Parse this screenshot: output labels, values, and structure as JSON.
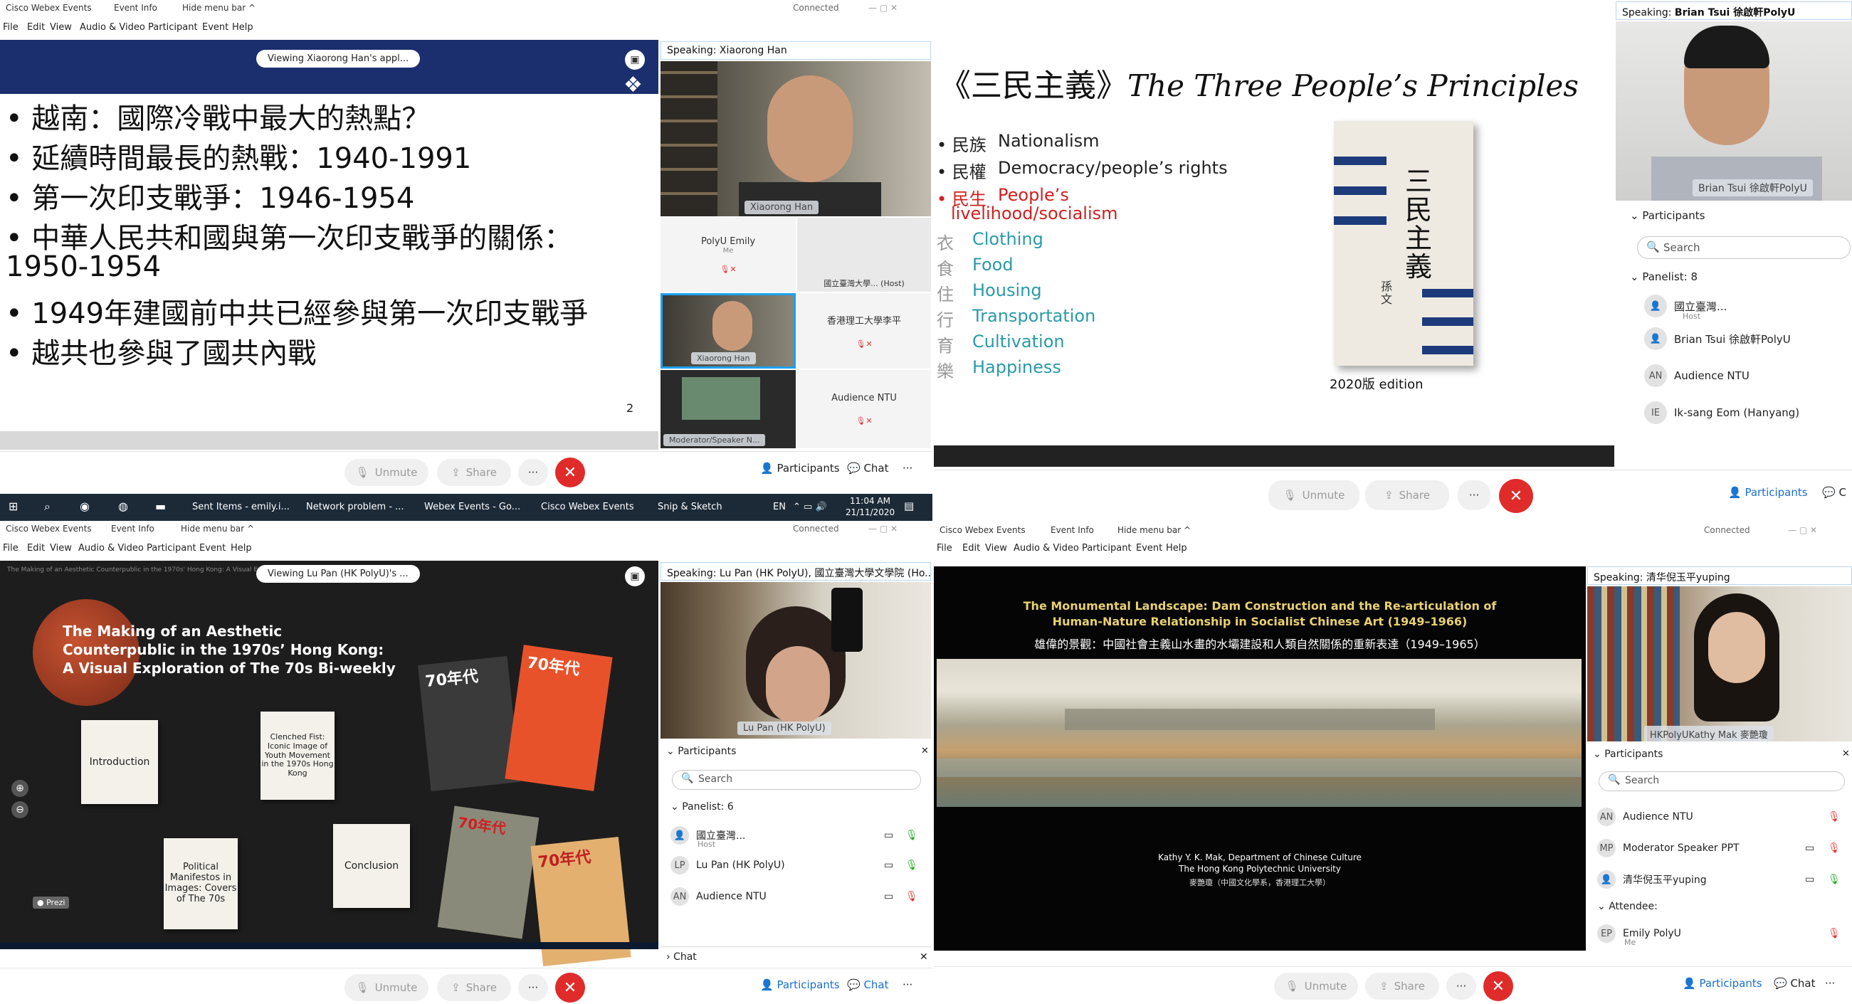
{
  "q1": {
    "menubar": {
      "app": "Cisco Webex Events",
      "event_info": "Event Info",
      "hide_menu": "Hide menu bar ^",
      "connected": "Connected"
    },
    "menu": [
      "File",
      "Edit",
      "View",
      "Audio & Video",
      "Participant",
      "Event",
      "Help"
    ],
    "viewing_pill": "Viewing Xiaorong Han's appl...",
    "slide_bullets": [
      "• 越南：國際冷戰中最大的熱點？",
      "• 延續時間最長的熱戰：1940-1991",
      "• 第一次印支戰爭：1946-1954",
      "• 中華人民共和國與第一次印支戰爭的關係：",
      "  1950-1954",
      "• 1949年建國前中共已經參與第一次印支戰爭",
      "• 越共也參與了國共內戰"
    ],
    "slide_page": "2",
    "speaking_label": "Speaking:",
    "speaking_name": "Xiaorong Han",
    "main_nameplate": "Xiaorong Han",
    "tiles": {
      "polyu_emily": "PolyU Emily",
      "me": "Me",
      "ntu_tile_name": "國立臺灣大學... (Host)",
      "xiaorong": "Xiaorong Han",
      "hk_polyu": "香港理工大學李平",
      "audience_ntu": "Audience NTU",
      "moderator": "Moderator/Speaker N..."
    },
    "controls": {
      "unmute": "Unmute",
      "share": "Share",
      "more": "···",
      "participants": "Participants",
      "chat": "Chat"
    }
  },
  "q2": {
    "title_cn": "《三民主義》",
    "title_en": "The Three People’s Principles",
    "items": [
      {
        "cn": "• 民族",
        "en": "Nationalism",
        "color": "#222"
      },
      {
        "cn": "• 民權",
        "en": "Democracy/people’s rights",
        "color": "#222"
      },
      {
        "cn": "• 民生",
        "en": "People’s",
        "color": "#d02020"
      }
    ],
    "livelihood": "livelihood/socialism",
    "sub": [
      {
        "cn": "衣",
        "en": "Clothing"
      },
      {
        "cn": "食",
        "en": "Food"
      },
      {
        "cn": "住",
        "en": "Housing"
      },
      {
        "cn": "行",
        "en": "Transportation"
      },
      {
        "cn": "育",
        "en": "Cultivation"
      },
      {
        "cn": "樂",
        "en": "Happiness"
      }
    ],
    "book_title": "三民主義",
    "book_author": "孫文",
    "edition": "2020版 edition",
    "speaking_label": "Speaking:",
    "speaking_name": "Brian Tsui 徐啟軒PolyU",
    "video_nameplate": "Brian Tsui 徐啟軒PolyU",
    "participants_title": "Participants",
    "search": "Search",
    "panelist": "Panelist: 8",
    "people": [
      {
        "av": "👤",
        "name": "國立臺灣...",
        "sub": "Host"
      },
      {
        "av": "👤",
        "name": "Brian Tsui 徐啟軒PolyU",
        "sub": ""
      },
      {
        "av": "AN",
        "name": "Audience NTU",
        "sub": ""
      },
      {
        "av": "IE",
        "name": "Ik-sang Eom (Hanyang)",
        "sub": ""
      }
    ],
    "controls": {
      "unmute": "Unmute",
      "share": "Share",
      "more": "···",
      "participants": "Participants",
      "chat": "C"
    }
  },
  "taskbar": {
    "items": [
      "Sent Items - emily.i...",
      "Network problem - ...",
      "Webex Events - Go...",
      "Cisco Webex Events",
      "Snip & Sketch"
    ],
    "lang": "EN",
    "time": "11:04 AM",
    "date": "21/11/2020"
  },
  "q3": {
    "menubar": {
      "app": "Cisco Webex Events",
      "event_info": "Event Info",
      "hide_menu": "Hide menu bar ^",
      "connected": "Connected"
    },
    "menu": [
      "File",
      "Edit",
      "View",
      "Audio & Video",
      "Participant",
      "Event",
      "Help"
    ],
    "viewing_pill": "Viewing Lu Pan (HK PolyU)'s ...",
    "prezi_header": "The Making of an Aesthetic Counterpublic in the 1970s' Hong Kong: A Visual Exploration of The 70s Bi-weekly",
    "prezi_title": "The Making of an Aesthetic Counterpublic in the 1970s’ Hong Kong: A Visual Exploration of The 70s Bi-weekly",
    "cards": {
      "intro": "Introduction",
      "fist": "Clenched Fist: Iconic Image of Youth Movement in the 1970s Hong Kong",
      "political": "Political Manifestos in Images: Covers of The 70s",
      "conclusion": "Conclusion"
    },
    "prezi_badge": "Prezi",
    "mag_labels": {
      "m1": "70年代",
      "m2": "70年代",
      "m3": "70年代",
      "m4": "70年代"
    },
    "speaking_label": "Speaking:",
    "speaking_name": "Lu Pan (HK PolyU), 國立臺灣大學文學院 (Ho...",
    "video_nameplate": "Lu Pan (HK PolyU)",
    "participants_title": "Participants",
    "search": "Search",
    "panelist": "Panelist: 6",
    "people": [
      {
        "av": "👤",
        "name": "國立臺灣...",
        "sub": "Host"
      },
      {
        "av": "LP",
        "name": "Lu Pan (HK PolyU)",
        "sub": ""
      },
      {
        "av": "AN",
        "name": "Audience NTU",
        "sub": ""
      }
    ],
    "chat": "Chat",
    "controls": {
      "unmute": "Unmute",
      "share": "Share",
      "more": "···",
      "participants": "Participants",
      "chat": "Chat"
    }
  },
  "q4": {
    "menubar": {
      "app": "Cisco Webex Events",
      "event_info": "Event Info",
      "hide_menu": "Hide menu bar ^",
      "connected": "Connected"
    },
    "menu": [
      "File",
      "Edit",
      "View",
      "Audio & Video",
      "Participant",
      "Event",
      "Help"
    ],
    "title_en1": "The Monumental Landscape: Dam Construction and the Re-articulation of",
    "title_en2": "Human-Nature Relationship in Socialist Chinese Art (1949–1966)",
    "title_cn": "雄偉的景觀：中國社會主義山水畫的水壩建設和人類自然關係的重新表達（1949–1965）",
    "author1": "Kathy Y. K. Mak, Department of Chinese Culture",
    "author2": "The Hong Kong Polytechnic University",
    "author3": "麥艷瓊（中國文化學系，香港理工大學）",
    "speaking_label": "Speaking:",
    "speaking_name": "清华倪玉平yuping",
    "video_nameplate": "HKPolyUKathy Mak 麥艷瓊",
    "participants_title": "Participants",
    "search": "Search",
    "people": [
      {
        "av": "AN",
        "name": "Audience NTU",
        "sub": ""
      },
      {
        "av": "MP",
        "name": "Moderator Speaker PPT",
        "sub": ""
      },
      {
        "av": "👤",
        "name": "清华倪玉平yuping",
        "sub": ""
      }
    ],
    "attendee": "Attendee:",
    "attendee_people": [
      {
        "av": "EP",
        "name": "Emily PolyU",
        "sub": "Me"
      }
    ],
    "controls": {
      "unmute": "Unmute",
      "share": "Share",
      "more": "···",
      "participants": "Participants",
      "chat": "Chat"
    }
  }
}
